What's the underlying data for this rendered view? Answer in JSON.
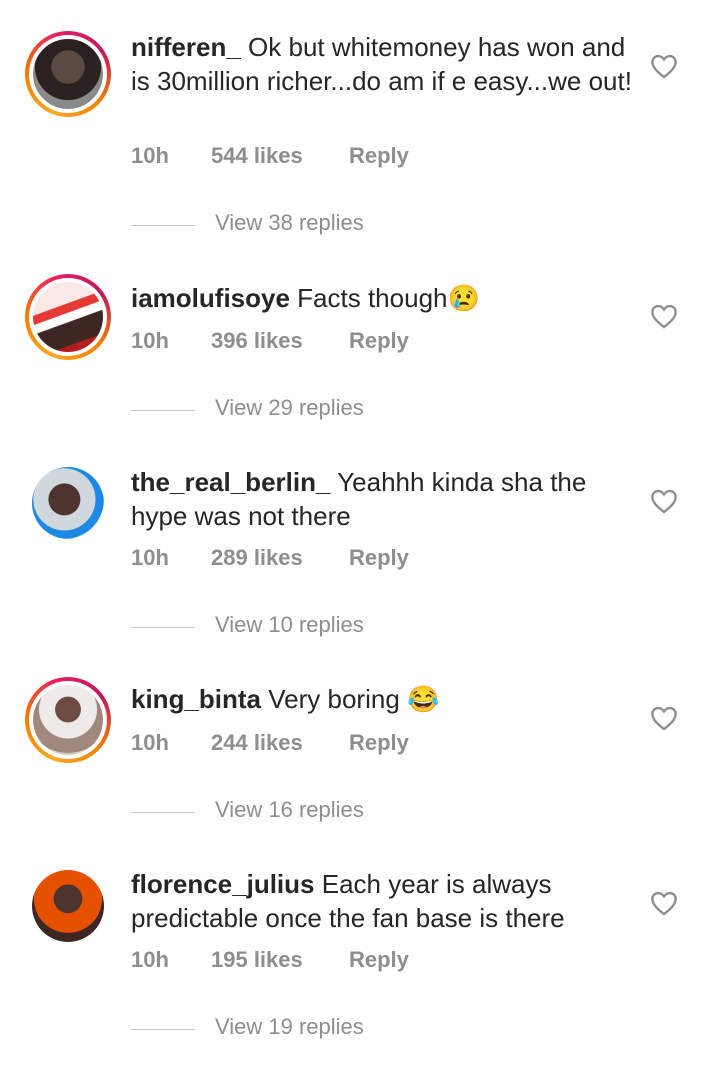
{
  "comments": [
    {
      "username": "nifferen_",
      "text": "Ok but whitemoney has won and is 30million richer...do am if e easy...we out!",
      "time": "10h",
      "likes": "544 likes",
      "reply": "Reply",
      "view_replies": "View 38 replies"
    },
    {
      "username": "iamolufisoye",
      "text": "Facts though😢",
      "time": "10h",
      "likes": "396 likes",
      "reply": "Reply",
      "view_replies": "View 29 replies"
    },
    {
      "username": "the_real_berlin_",
      "text": "Yeahhh kinda sha the hype was not there",
      "time": "10h",
      "likes": "289 likes",
      "reply": "Reply",
      "view_replies": "View 10 replies"
    },
    {
      "username": "king_binta",
      "text": "Very boring 😂",
      "time": "10h",
      "likes": "244 likes",
      "reply": "Reply",
      "view_replies": "View 16 replies"
    },
    {
      "username": "florence_julius",
      "text": "Each year is always predictable once the fan base is there",
      "time": "10h",
      "likes": "195 likes",
      "reply": "Reply",
      "view_replies": "View 19 replies"
    }
  ],
  "icons": {
    "like": "heart-outline-icon"
  },
  "colors": {
    "text": "#262626",
    "secondary": "#8e8e8e",
    "divider": "#c7c7c7"
  }
}
